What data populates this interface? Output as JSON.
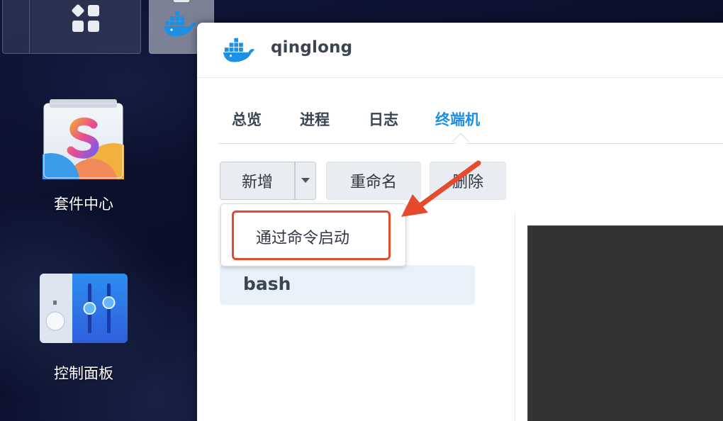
{
  "desktop": {
    "apps": [
      {
        "label": "套件中心",
        "icon": "package-center-icon"
      },
      {
        "label": "控制面板",
        "icon": "control-panel-icon"
      }
    ]
  },
  "taskbar": {
    "items": [
      {
        "icon": "main-menu-grid-icon"
      },
      {
        "icon": "docker-whale-icon"
      }
    ]
  },
  "window": {
    "title": "qinglong",
    "icon": "docker-whale-icon",
    "tabs": [
      {
        "label": "总览",
        "active": false
      },
      {
        "label": "进程",
        "active": false
      },
      {
        "label": "日志",
        "active": false
      },
      {
        "label": "终端机",
        "active": true
      }
    ],
    "toolbar": {
      "new_label": "新增",
      "rename_label": "重命名",
      "delete_label": "删除"
    },
    "dropdown": {
      "items": [
        {
          "label": "通过命令启动",
          "highlighted": true
        }
      ]
    },
    "terminal_list": [
      {
        "label": "bash",
        "selected": true
      }
    ]
  },
  "colors": {
    "accent": "#1d8fe5",
    "highlight_box": "#e54a2c",
    "text": "#3b4453",
    "terminal_bg": "#333333"
  }
}
